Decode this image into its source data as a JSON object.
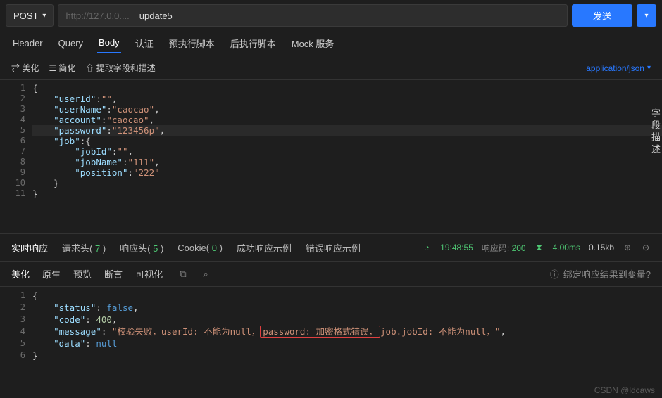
{
  "request": {
    "method": "POST",
    "url_placeholder": "http://127.0.0....",
    "name": "update5",
    "send_label": "发送"
  },
  "req_tabs": [
    "Header",
    "Query",
    "Body",
    "认证",
    "预执行脚本",
    "后执行脚本",
    "Mock 服务"
  ],
  "req_tab_active": 2,
  "body_toolbar": {
    "beautify": "⇄ 美化",
    "simplify": "☰ 简化",
    "extract": "⇧ 提取字段和描述",
    "content_type": "application/json"
  },
  "field_desc_label": "字段描述",
  "body_lines": [
    {
      "n": 1,
      "raw": "{",
      "tokens": [
        {
          "t": "punct",
          "v": "{"
        }
      ]
    },
    {
      "n": 2,
      "raw": "    \"userId\":\"\",",
      "tokens": [
        {
          "t": "ind",
          "v": "    "
        },
        {
          "t": "key",
          "v": "\"userId\""
        },
        {
          "t": "colon",
          "v": ":"
        },
        {
          "t": "str",
          "v": "\"\""
        },
        {
          "t": "punct",
          "v": ","
        }
      ]
    },
    {
      "n": 3,
      "raw": "    \"userName\":\"caocao\",",
      "tokens": [
        {
          "t": "ind",
          "v": "    "
        },
        {
          "t": "key",
          "v": "\"userName\""
        },
        {
          "t": "colon",
          "v": ":"
        },
        {
          "t": "str",
          "v": "\"caocao\""
        },
        {
          "t": "punct",
          "v": ","
        }
      ]
    },
    {
      "n": 4,
      "raw": "    \"account\":\"caocao\",",
      "tokens": [
        {
          "t": "ind",
          "v": "    "
        },
        {
          "t": "key",
          "v": "\"account\""
        },
        {
          "t": "colon",
          "v": ":"
        },
        {
          "t": "str",
          "v": "\"caocao\""
        },
        {
          "t": "punct",
          "v": ","
        }
      ]
    },
    {
      "n": 5,
      "hl": true,
      "raw": "    \"password\":\"123456p\",",
      "tokens": [
        {
          "t": "ind",
          "v": "    "
        },
        {
          "t": "key",
          "v": "\"password\""
        },
        {
          "t": "colon",
          "v": ":"
        },
        {
          "t": "str",
          "v": "\"123456p\""
        },
        {
          "t": "punct",
          "v": ","
        }
      ]
    },
    {
      "n": 6,
      "raw": "    \"job\":{",
      "tokens": [
        {
          "t": "ind",
          "v": "    "
        },
        {
          "t": "key",
          "v": "\"job\""
        },
        {
          "t": "colon",
          "v": ":"
        },
        {
          "t": "punct",
          "v": "{"
        }
      ]
    },
    {
      "n": 7,
      "raw": "        \"jobId\":\"\",",
      "tokens": [
        {
          "t": "ind",
          "v": "        "
        },
        {
          "t": "key",
          "v": "\"jobId\""
        },
        {
          "t": "colon",
          "v": ":"
        },
        {
          "t": "str",
          "v": "\"\""
        },
        {
          "t": "punct",
          "v": ","
        }
      ]
    },
    {
      "n": 8,
      "raw": "        \"jobName\":\"111\",",
      "tokens": [
        {
          "t": "ind",
          "v": "        "
        },
        {
          "t": "key",
          "v": "\"jobName\""
        },
        {
          "t": "colon",
          "v": ":"
        },
        {
          "t": "str",
          "v": "\"111\""
        },
        {
          "t": "punct",
          "v": ","
        }
      ]
    },
    {
      "n": 9,
      "raw": "        \"position\":\"222\"",
      "tokens": [
        {
          "t": "ind",
          "v": "        "
        },
        {
          "t": "key",
          "v": "\"position\""
        },
        {
          "t": "colon",
          "v": ":"
        },
        {
          "t": "str",
          "v": "\"222\""
        }
      ]
    },
    {
      "n": 10,
      "raw": "    }",
      "tokens": [
        {
          "t": "ind",
          "v": "    "
        },
        {
          "t": "punct",
          "v": "}"
        }
      ]
    },
    {
      "n": 11,
      "raw": "}",
      "tokens": [
        {
          "t": "punct",
          "v": "}"
        }
      ]
    }
  ],
  "resp_tabs": [
    {
      "label": "实时响应",
      "count": null,
      "active": true
    },
    {
      "label": "请求头",
      "count": 7
    },
    {
      "label": "响应头",
      "count": 5
    },
    {
      "label": "Cookie",
      "count": 0
    },
    {
      "label": "成功响应示例",
      "count": null
    },
    {
      "label": "错误响应示例",
      "count": null
    }
  ],
  "resp_meta": {
    "time": "19:48:55",
    "status_label": "响应码:",
    "status_code": "200",
    "duration": "4.00ms",
    "size": "0.15kb"
  },
  "view_tabs": [
    "美化",
    "原生",
    "预览",
    "断言",
    "可视化"
  ],
  "view_tab_active": 0,
  "bind_result_label": "绑定响应结果到变量?",
  "resp_lines": [
    {
      "n": 1,
      "segs": [
        {
          "t": "punct",
          "v": "{"
        }
      ]
    },
    {
      "n": 2,
      "segs": [
        {
          "t": "ind",
          "v": "    "
        },
        {
          "t": "key",
          "v": "\"status\""
        },
        {
          "t": "colon",
          "v": ": "
        },
        {
          "t": "kw",
          "v": "false"
        },
        {
          "t": "punct",
          "v": ","
        }
      ]
    },
    {
      "n": 3,
      "segs": [
        {
          "t": "ind",
          "v": "    "
        },
        {
          "t": "key",
          "v": "\"code\""
        },
        {
          "t": "colon",
          "v": ": "
        },
        {
          "t": "num",
          "v": "400"
        },
        {
          "t": "punct",
          "v": ","
        }
      ]
    },
    {
      "n": 4,
      "segs": [
        {
          "t": "ind",
          "v": "    "
        },
        {
          "t": "key",
          "v": "\"message\""
        },
        {
          "t": "colon",
          "v": ": "
        },
        {
          "t": "str",
          "v": "\"校验失败，userId: 不能为null，"
        },
        {
          "t": "errbox",
          "v": "password: 加密格式错误，"
        },
        {
          "t": "str",
          "v": "job.jobId: 不能为null，\""
        },
        {
          "t": "punct",
          "v": ","
        }
      ]
    },
    {
      "n": 5,
      "segs": [
        {
          "t": "ind",
          "v": "    "
        },
        {
          "t": "key",
          "v": "\"data\""
        },
        {
          "t": "colon",
          "v": ": "
        },
        {
          "t": "kw",
          "v": "null"
        }
      ]
    },
    {
      "n": 6,
      "segs": [
        {
          "t": "punct",
          "v": "}"
        }
      ]
    }
  ],
  "watermark": "CSDN @ldcaws"
}
